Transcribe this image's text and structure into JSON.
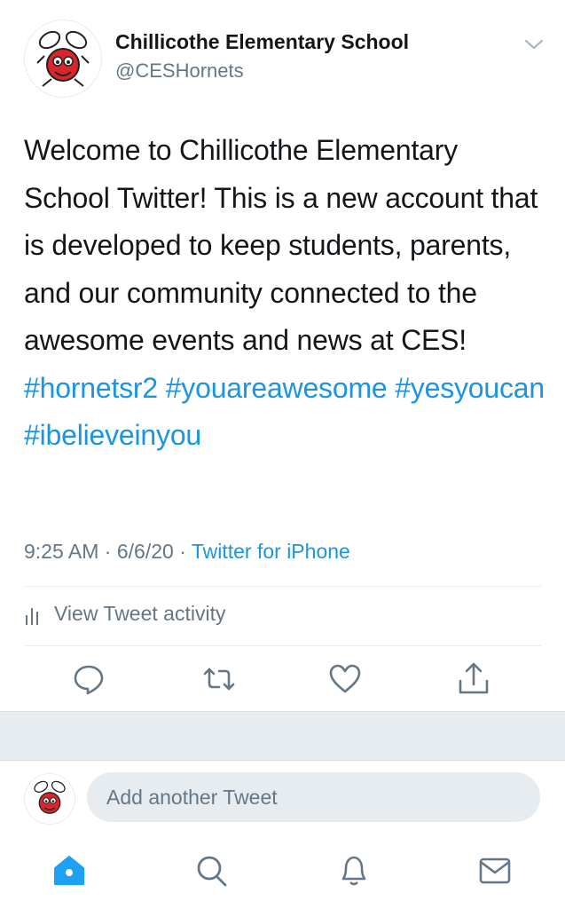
{
  "tweet": {
    "author_name": "Chillicothe Elementary School",
    "author_handle": "@CESHornets",
    "text_plain": "Welcome to Chillicothe Elementary School Twitter! This is a new account that is developed to keep students, parents, and our community connected to the awesome events and news at CES!",
    "hashtags": [
      "#hornetsr2",
      "#youareawesome",
      "#yesyoucan",
      "#ibelieveinyou"
    ],
    "time": "9:25 AM",
    "date": "6/6/20",
    "source": "Twitter for iPhone",
    "separator": "·"
  },
  "activity": {
    "label": "View Tweet activity"
  },
  "actions": [
    "reply-icon",
    "retweet-icon",
    "like-icon",
    "share-icon"
  ],
  "composer": {
    "placeholder": "Add another Tweet"
  },
  "bottom_nav": [
    "home-icon",
    "search-icon",
    "notifications-icon",
    "messages-icon"
  ],
  "colors": {
    "accent": "#1da1f2",
    "link": "#1b95e0",
    "muted": "#657786",
    "divider": "#e6ecf0",
    "text": "#14171a"
  }
}
